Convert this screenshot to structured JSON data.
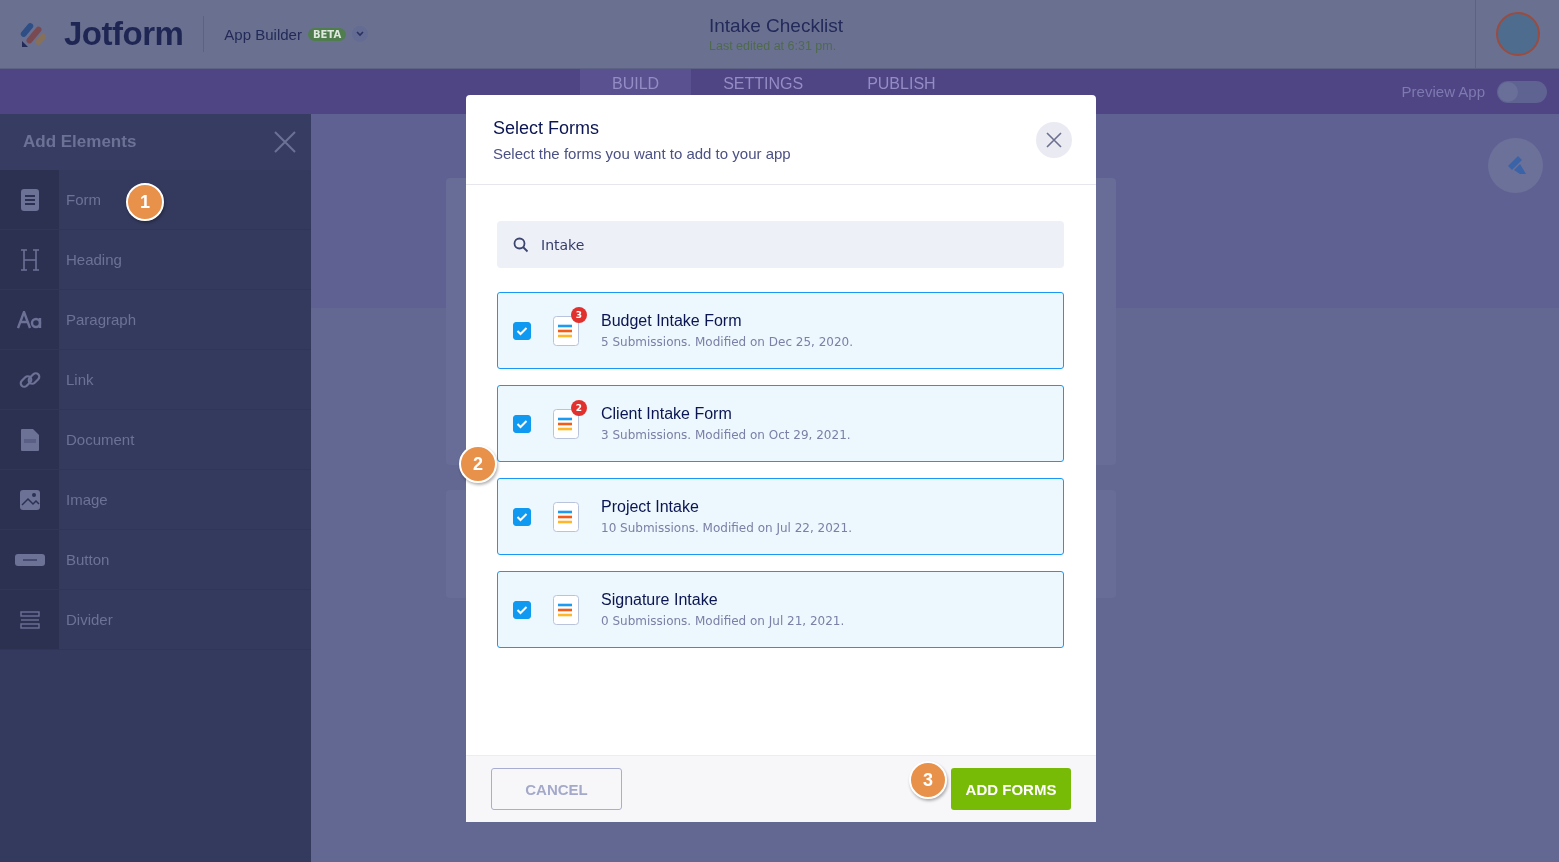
{
  "header": {
    "logo": "Jotform",
    "product": "App Builder",
    "badge": "BETA",
    "title": "Intake Checklist",
    "subtitle": "Last edited at 6:31 pm."
  },
  "tabs": [
    {
      "label": "BUILD",
      "selected": true
    },
    {
      "label": "SETTINGS",
      "selected": false
    },
    {
      "label": "PUBLISH",
      "selected": false
    }
  ],
  "preview": {
    "label": "Preview App",
    "on": false
  },
  "sidebar": {
    "title": "Add Elements",
    "items": [
      {
        "label": "Form",
        "kind": "form"
      },
      {
        "label": "Heading",
        "kind": "heading"
      },
      {
        "label": "Paragraph",
        "kind": "paragraph"
      },
      {
        "label": "Link",
        "kind": "link"
      },
      {
        "label": "Document",
        "kind": "document"
      },
      {
        "label": "Image",
        "kind": "image"
      },
      {
        "label": "Button",
        "kind": "button"
      },
      {
        "label": "Divider",
        "kind": "divider"
      }
    ]
  },
  "modal": {
    "title": "Select Forms",
    "subtitle": "Select the forms you want to add to your app",
    "search": {
      "value": "Intake"
    },
    "forms": [
      {
        "name": "Budget Intake Form",
        "meta": "5 Submissions. Modified on Dec 25, 2020.",
        "checked": true,
        "badge": "3"
      },
      {
        "name": "Client Intake Form",
        "meta": "3 Submissions. Modified on Oct 29, 2021.",
        "checked": true,
        "badge": "2"
      },
      {
        "name": "Project Intake",
        "meta": "10 Submissions. Modified on Jul 22, 2021.",
        "checked": true
      },
      {
        "name": "Signature Intake",
        "meta": "0 Submissions. Modified on Jul 21, 2021.",
        "checked": true
      }
    ],
    "cancel": "CANCEL",
    "submit": "ADD FORMS"
  },
  "steps": [
    "1",
    "2",
    "3"
  ]
}
